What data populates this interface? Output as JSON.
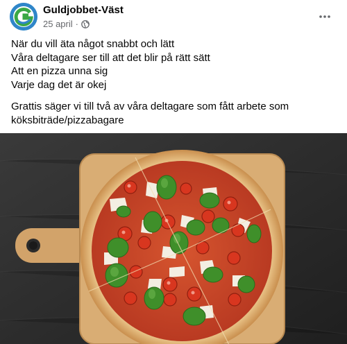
{
  "post": {
    "author": "Guldjobbet-Väst",
    "date": "25 april",
    "separator": "·",
    "privacy_icon": "globe-icon",
    "more_icon": "more-options-icon",
    "lines": [
      "När du vill äta något snabbt och lätt",
      "Våra deltagare ser till att det blir på rätt sätt",
      "Att en pizza unna sig",
      "Varje dag det är okej"
    ],
    "paragraph": "Grattis säger vi till två av våra deltagare som fått arbete som köksbiträde/pizzabagare",
    "image_subject": "pizza-photo"
  },
  "colors": {
    "text": "#050505",
    "secondary_text": "#65676b",
    "avatar_blue": "#2f86c9",
    "avatar_green": "#3aa845",
    "background_dark": "#2c2c2c",
    "board_wood": "#d9ad74",
    "crust": "#e9bf7e",
    "sauce": "#c9452a",
    "basil": "#3f8f2a",
    "tomato": "#d8361f",
    "cheese": "#f3eee2"
  }
}
